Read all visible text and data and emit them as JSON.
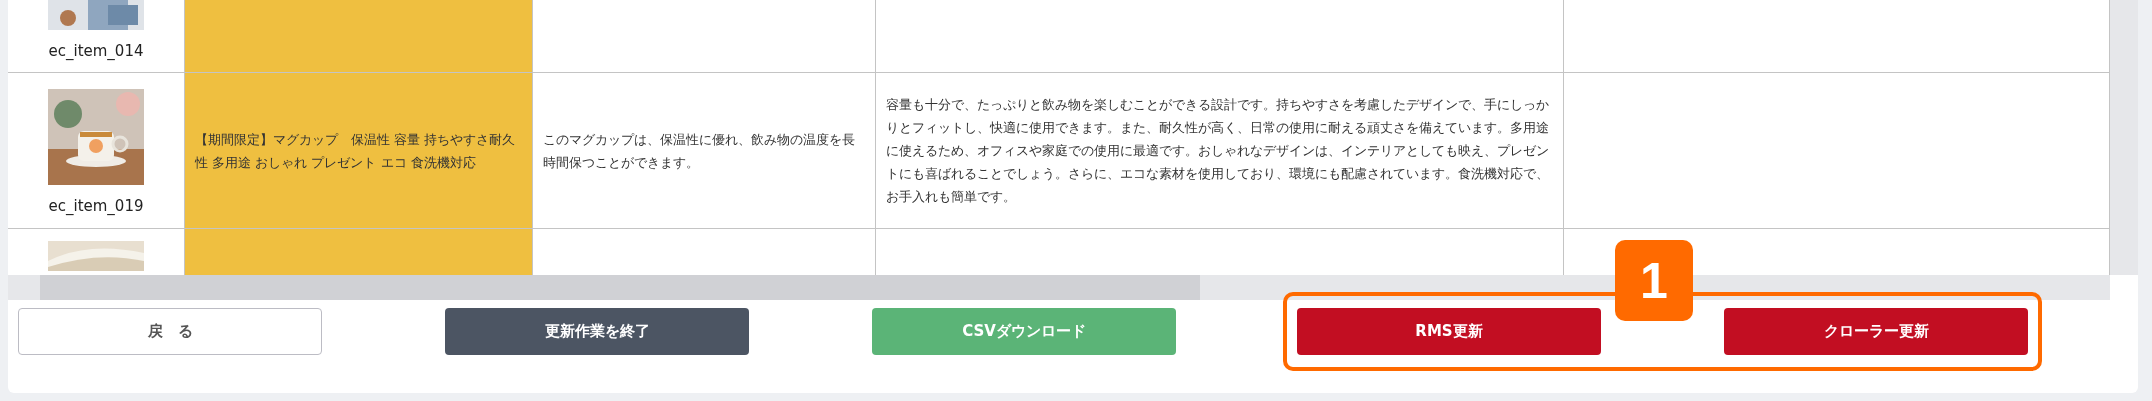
{
  "table": {
    "rows": [
      {
        "kind": "partial",
        "code": "ec_item_014",
        "title": "",
        "description": "",
        "detail": ""
      },
      {
        "kind": "full",
        "code": "ec_item_019",
        "title": "【期間限定】マグカップ　保温性 容量 持ちやすさ耐久性 多用途 おしゃれ プレゼント エコ 食洗機対応",
        "description": "このマグカップは、保温性に優れ、飲み物の温度を長時間保つことができます。",
        "detail": "容量も十分で、たっぷりと飲み物を楽しむことができる設計です。持ちやすさを考慮したデザインで、手にしっかりとフィットし、快適に使用できます。また、耐久性が高く、日常の使用に耐える頑丈さを備えています。多用途に使えるため、オフィスや家庭での使用に最適です。おしゃれなデザインは、インテリアとしても映え、プレゼントにも喜ばれることでしょう。さらに、エコな素材を使用しており、環境にも配慮されています。食洗機対応で、お手入れも簡単です。"
      },
      {
        "kind": "cut",
        "code": "",
        "title": "",
        "description": "",
        "detail": ""
      }
    ]
  },
  "buttons": [
    {
      "label": "戻　る",
      "kind": "outline"
    },
    {
      "label": "更新作業を終了",
      "kind": "dark"
    },
    {
      "label": "CSVダウンロード",
      "kind": "green"
    }
  ],
  "highlight": {
    "badge": "1",
    "buttons": [
      {
        "label": "RMS更新",
        "kind": "red"
      },
      {
        "label": "クローラー更新",
        "kind": "red"
      }
    ]
  }
}
